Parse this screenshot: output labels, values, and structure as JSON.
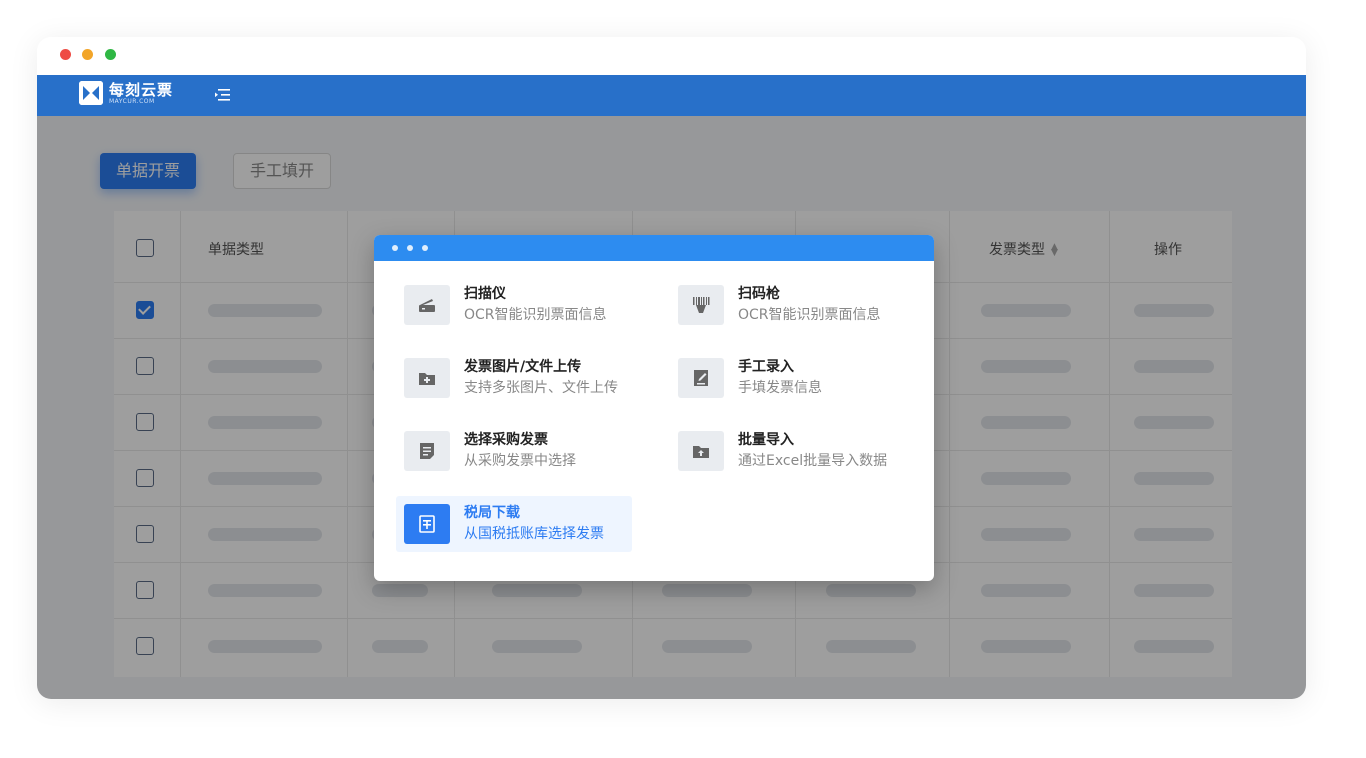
{
  "app": {
    "logo_name": "每刻云票",
    "logo_sub": "MAYCUR.COM"
  },
  "tabs": [
    {
      "label": "单据开票",
      "active": true
    },
    {
      "label": "手工填开",
      "active": false
    }
  ],
  "table": {
    "headers": {
      "type": "单据类型",
      "invoice_type": "发票类型",
      "action": "操作"
    },
    "rows": [
      {
        "checked": false
      },
      {
        "checked": true
      },
      {
        "checked": false
      },
      {
        "checked": false
      },
      {
        "checked": false
      },
      {
        "checked": false
      },
      {
        "checked": false
      },
      {
        "checked": false
      }
    ]
  },
  "dialog": {
    "items": [
      {
        "title": "扫描仪",
        "desc": "OCR智能识别票面信息",
        "icon": "scanner-icon"
      },
      {
        "title": "扫码枪",
        "desc": "OCR智能识别票面信息",
        "icon": "barcode-gun-icon"
      },
      {
        "title": "发票图片/文件上传",
        "desc": "支持多张图片、文件上传",
        "icon": "folder-add-icon"
      },
      {
        "title": "手工录入",
        "desc": "手填发票信息",
        "icon": "edit-document-icon"
      },
      {
        "title": "选择采购发票",
        "desc": "从采购发票中选择",
        "icon": "document-icon"
      },
      {
        "title": "批量导入",
        "desc": "通过Excel批量导入数据",
        "icon": "folder-upload-icon"
      },
      {
        "title": "税局下载",
        "desc": "从国税抵账库选择发票",
        "icon": "tax-icon"
      }
    ]
  },
  "colors": {
    "nav": "#2870c9",
    "primary": "#2d7cf2",
    "dialog_bar": "#2d8cf0"
  }
}
